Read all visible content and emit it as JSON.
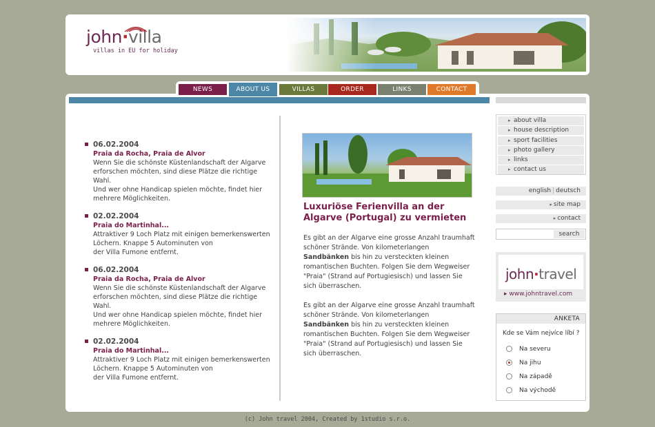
{
  "logo": {
    "john": "john",
    "villa": "villa",
    "tagline": "villas in EU for holiday"
  },
  "tabs": [
    {
      "label": "news",
      "color": "#7a1f4a"
    },
    {
      "label": "about us",
      "color": "#4d87a8"
    },
    {
      "label": "villas",
      "color": "#6b7a3a"
    },
    {
      "label": "order",
      "color": "#a8281d"
    },
    {
      "label": "links",
      "color": "#7a8070"
    },
    {
      "label": "contact",
      "color": "#e07a2a"
    }
  ],
  "news": [
    {
      "date": "06.02.2004",
      "title": "Praia da Rocha, Praia de Alvor",
      "text": [
        "Wenn Sie die schönste Küstenlandschaft der Algarve",
        "erforschen möchten, sind diese Plätze die richtige Wahl.",
        "Und wer ohne Handicap spielen möchte, findet hier",
        "mehrere Möglichkeiten."
      ]
    },
    {
      "date": "02.02.2004",
      "title": "Praia do Martinhal...",
      "text": [
        "Attraktiver 9 Loch Platz mit einigen bemerkenswerten",
        "Löchern. Knappe 5 Autominuten von",
        "der Villa Fumone entfernt."
      ]
    },
    {
      "date": "06.02.2004",
      "title": "Praia da Rocha, Praia de Alvor",
      "text": [
        "Wenn Sie die schönste Küstenlandschaft der Algarve",
        "erforschen möchten, sind diese Plätze die richtige Wahl.",
        "Und wer ohne Handicap spielen möchte, findet hier",
        "mehrere Möglichkeiten."
      ]
    },
    {
      "date": "02.02.2004",
      "title": "Praia do Martinhal...",
      "text": [
        "Attraktiver 9 Loch Platz mit einigen bemerkenswerten",
        "Löchern. Knappe 5 Autominuten von",
        "der Villa Fumone entfernt."
      ]
    }
  ],
  "article": {
    "title": "Luxuriöse Ferienvilla an der Algarve (Portugal) zu vermieten",
    "p1_before": "Es gibt an der Algarve eine grosse Anzahl traumhaft schöner Strände. Von kilometerlangen ",
    "p1_bold": "Sandbänken",
    "p1_after": " bis hin zu versteckten kleinen romantischen Buchten. Folgen Sie dem Wegweiser \"Praia\" (Strand auf Portugiesisch) und lassen Sie sich überraschen.",
    "p2_before": "Es gibt an der Algarve eine grosse Anzahl traumhaft schöner Strände. Von kilometerlangen ",
    "p2_bold": "Sandbänken",
    "p2_after": " bis hin zu versteckten kleinen romantischen Buchten. Folgen Sie dem Wegweiser \"Praia\" (Strand auf Portugiesisch) und lassen Sie sich überraschen."
  },
  "sidebar": {
    "menu": [
      "about villa",
      "house description",
      "sport facilities",
      "photo gallery",
      "links",
      "contact us"
    ],
    "lang_en": "english",
    "lang_de": "deutsch",
    "sitemap": "site map",
    "contact": "contact",
    "search_button": "search",
    "search_value": ""
  },
  "banner": {
    "john": "john",
    "travel": "travel",
    "url": "www.johntravel.com"
  },
  "poll": {
    "title": "ANKETA",
    "question": "Kde se Vám nejvíce líbí ?",
    "options": [
      "Na severu",
      "Na jihu",
      "Na západě",
      "Na východě"
    ],
    "selected_index": 1
  },
  "footer": "(c) John travel 2004, Created by 1studio s.r.o.",
  "colors": {
    "accent": "#4d87a8",
    "brand": "#7a1f4a",
    "background": "#a8aa98"
  }
}
